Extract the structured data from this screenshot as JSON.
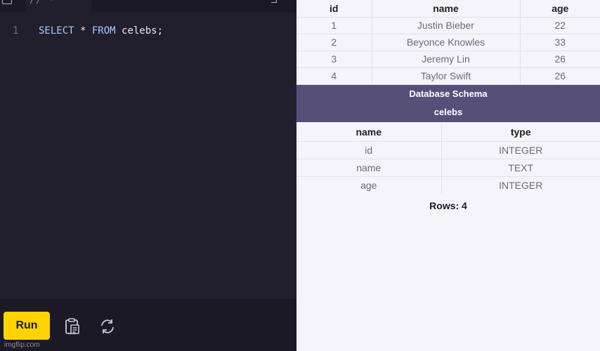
{
  "editor": {
    "line_number": "1",
    "code": [
      {
        "text": "SELECT",
        "kw": true
      },
      {
        "text": " * ",
        "kw": false
      },
      {
        "text": "FROM",
        "kw": true
      },
      {
        "text": " celebs;",
        "kw": false
      }
    ],
    "run_label": "Run",
    "icons": {
      "clipboard": "clipboard-icon",
      "reset": "refresh-icon",
      "file": "file-icon",
      "expand": "expand-icon"
    }
  },
  "results": {
    "columns": [
      "id",
      "name",
      "age"
    ],
    "rows": [
      [
        "1",
        "Justin Bieber",
        "22"
      ],
      [
        "2",
        "Beyonce Knowles",
        "33"
      ],
      [
        "3",
        "Jeremy Lin",
        "26"
      ],
      [
        "4",
        "Taylor Swift",
        "26"
      ]
    ]
  },
  "schema": {
    "title": "Database Schema",
    "table_name": "celebs",
    "columns": [
      "name",
      "type"
    ],
    "rows": [
      [
        "id",
        "INTEGER"
      ],
      [
        "name",
        "TEXT"
      ],
      [
        "age",
        "INTEGER"
      ]
    ],
    "rows_label": "Rows: 4"
  },
  "watermark": "imgflip.com",
  "colors": {
    "run_button": "#ffd300",
    "editor_bg": "#211f2d",
    "schema_header": "#565079"
  }
}
